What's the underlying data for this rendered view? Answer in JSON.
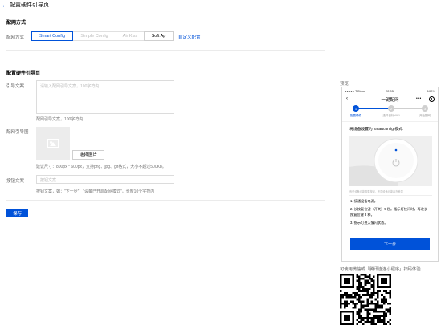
{
  "header": {
    "back_icon": "arrow-left-icon",
    "title": "配置硬件引导页"
  },
  "network": {
    "section_title": "配网方式",
    "label": "配网方式",
    "options": [
      {
        "label": "Smart Config",
        "state": "selected"
      },
      {
        "label": "Simple Config",
        "state": "disabled"
      },
      {
        "label": "Air Kiss",
        "state": "disabled"
      },
      {
        "label": "Soft Ap",
        "state": "enabled"
      }
    ],
    "custom_link": "自定义配置"
  },
  "guide": {
    "section_title": "配置硬件引导页",
    "text_label": "引导文案",
    "text_placeholder": "请输入配网引导文案，100字符内",
    "text_hint": "配网引导文案，100字符内",
    "image_label": "配网引导图",
    "image_icon": "image-placeholder-icon",
    "select_image_button": "选择图片",
    "image_hint": "建议尺寸：800px * 600px，支持png、jpg、gif格式，大小不超过500Kb。",
    "button_label": "按钮文案",
    "button_placeholder": "按钮文案",
    "button_hint": "按钮文案，如：“下一步”，“设备已开启配网模式”，长度10个字符内",
    "save": "保存"
  },
  "preview": {
    "label": "预览",
    "status_left": "●●●●● TCloud",
    "status_time": "22:05",
    "status_battery": "100%",
    "title": "一键配网",
    "more_icon": "more-icon",
    "target_icon": "target-icon",
    "steps": [
      {
        "num": "1",
        "label": "配置硬件"
      },
      {
        "num": "2",
        "label": "选择目标WiFi"
      },
      {
        "num": "3",
        "label": "开始配网"
      }
    ],
    "instruction": "将设备设置为 smartconfig 模式:",
    "device_hint": "有些设备可能需要按键，不同设备可能存在差异",
    "step_texts": [
      "1. 接通设备电源。",
      "2. 长按复位键（开关）5 秒。指示灯快闪时，再次长按复位键 3 秒。",
      "3. 指示灯进入慢闪状态。"
    ],
    "next_button": "下一步",
    "colors": {
      "accent": "#0052d9"
    }
  },
  "miniapp_tip": "可使用微信或「腾讯连连小程序」扫码体验",
  "qr_icon": "qr-code-icon"
}
